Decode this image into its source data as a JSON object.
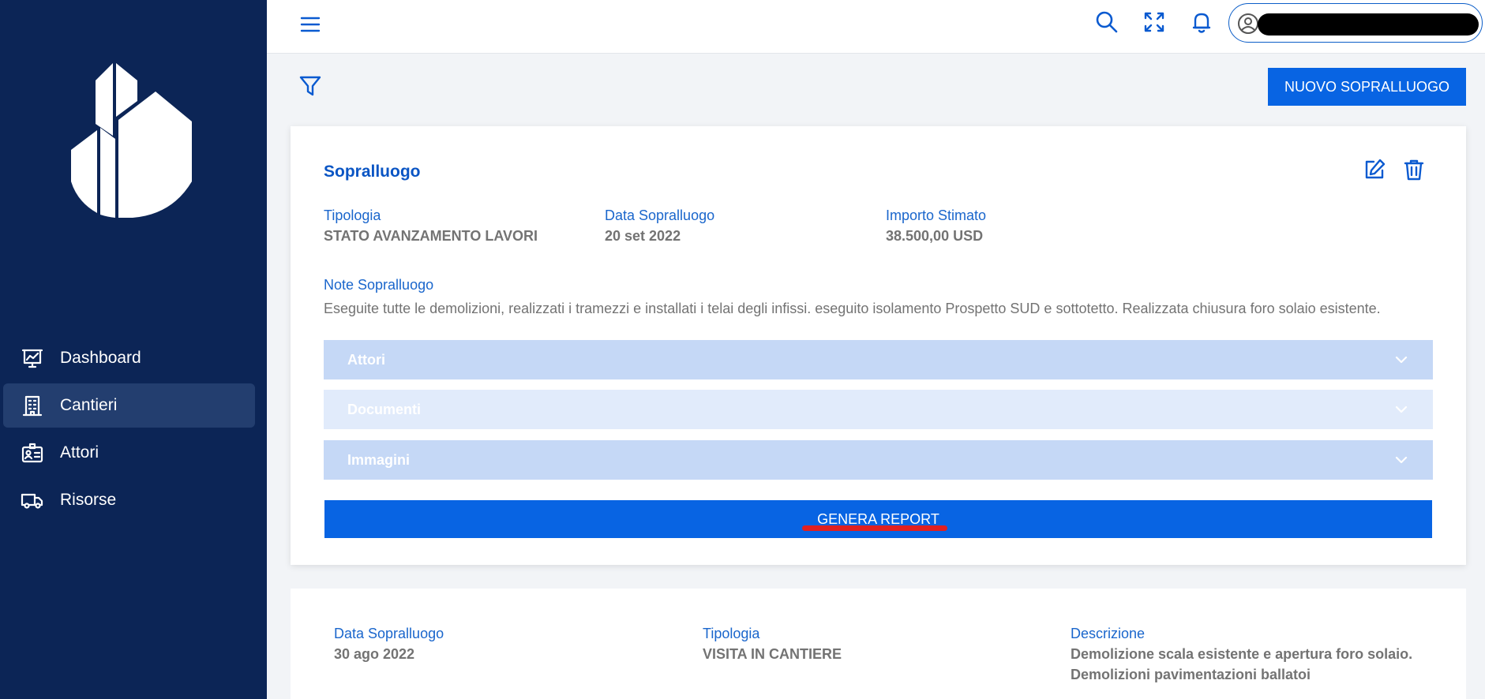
{
  "sidebar": {
    "items": [
      {
        "label": "Dashboard",
        "icon": "presentation-chart-icon",
        "active": false
      },
      {
        "label": "Cantieri",
        "icon": "building-icon",
        "active": true
      },
      {
        "label": "Attori",
        "icon": "id-card-icon",
        "active": false
      },
      {
        "label": "Risorse",
        "icon": "truck-icon",
        "active": false
      }
    ]
  },
  "header": {
    "icons": [
      "menu-icon",
      "search-icon",
      "fullscreen-icon",
      "bell-icon",
      "user-icon"
    ]
  },
  "toolbar": {
    "new_label": "NUOVO SOPRALLUOGO"
  },
  "card": {
    "title": "Sopralluogo",
    "fields": {
      "tipologia_label": "Tipologia",
      "tipologia_value": "STATO AVANZAMENTO LAVORI",
      "data_label": "Data Sopralluogo",
      "data_value": "20 set 2022",
      "importo_label": "Importo Stimato",
      "importo_value": "38.500,00 USD"
    },
    "note_label": "Note Sopralluogo",
    "note_value": "Eseguite tutte le demolizioni, realizzati i tramezzi e installati i telai degli infissi. eseguito isolamento Prospetto SUD e sottotetto. Realizzata chiusura foro solaio esistente.",
    "accordions": [
      {
        "label": "Attori"
      },
      {
        "label": "Documenti"
      },
      {
        "label": "Immagini"
      }
    ],
    "report_label": "GENERA REPORT"
  },
  "card2": {
    "data_label": "Data Sopralluogo",
    "data_value": "30 ago 2022",
    "tipologia_label": "Tipologia",
    "tipologia_value": "VISITA IN CANTIERE",
    "descrizione_label": "Descrizione",
    "descrizione_line1": "Demolizione scala esistente e apertura foro solaio.",
    "descrizione_line2": "Demolizioni pavimentazioni ballatoi"
  },
  "colors": {
    "sidebar_bg": "#0c2556",
    "accent": "#0864e3",
    "label_blue": "#1a66cc",
    "accordion_bg": "#c5d8f6",
    "highlight": "#e02020"
  }
}
